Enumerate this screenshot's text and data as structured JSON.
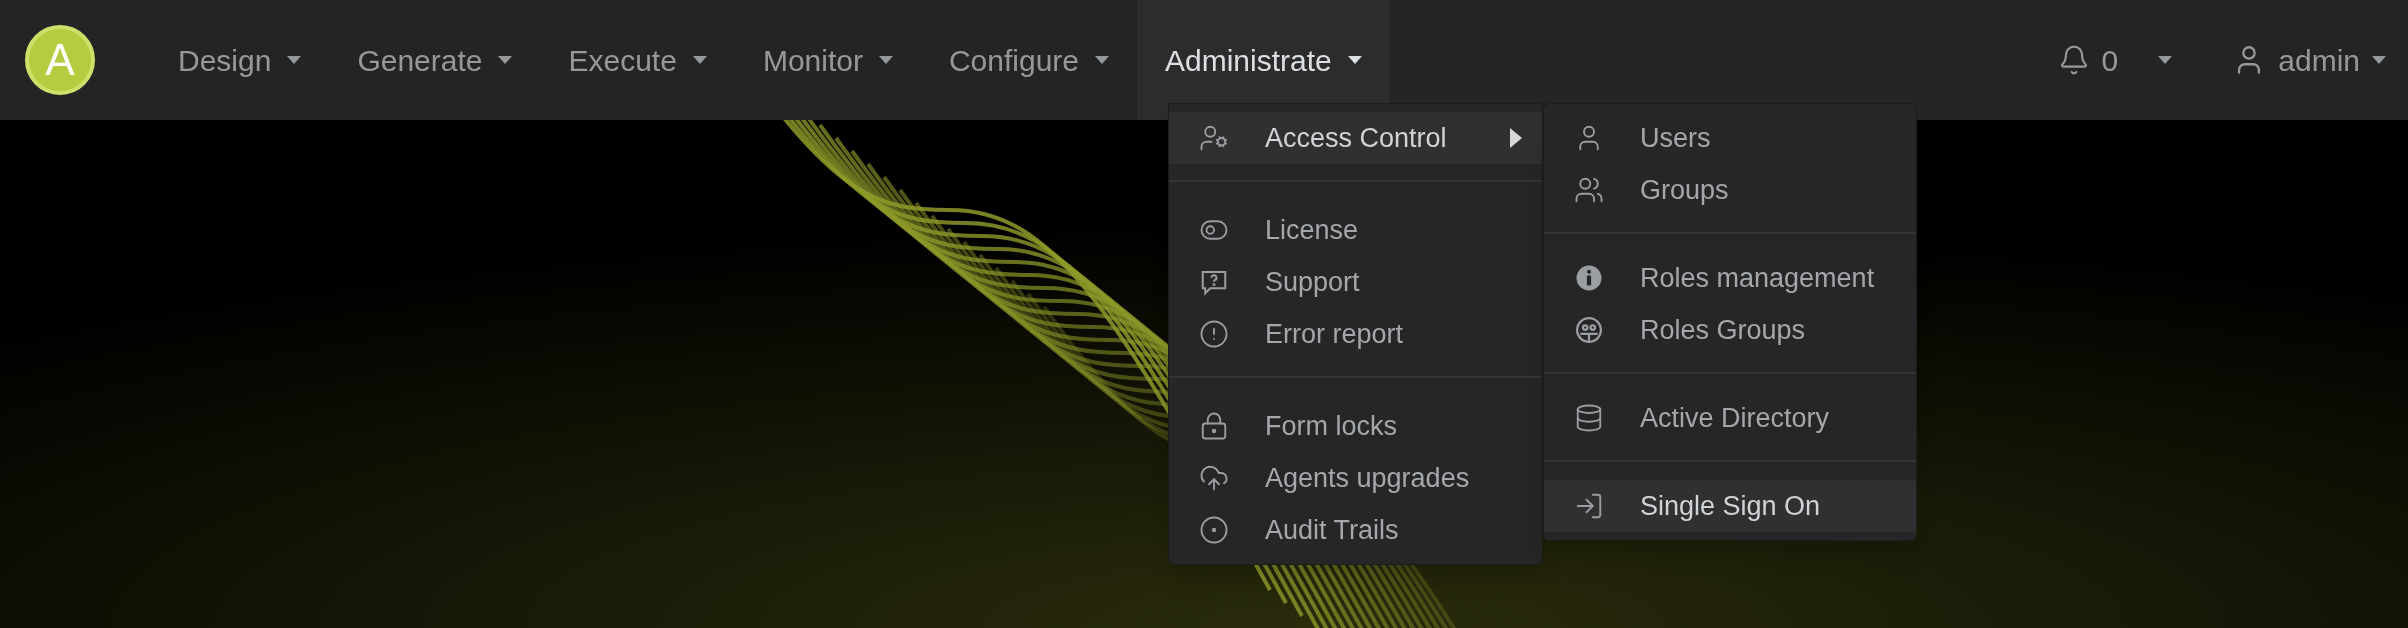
{
  "navbar": {
    "logo": "A",
    "items": [
      {
        "label": "Design",
        "selected": false
      },
      {
        "label": "Generate",
        "selected": false
      },
      {
        "label": "Execute",
        "selected": false
      },
      {
        "label": "Monitor",
        "selected": false
      },
      {
        "label": "Configure",
        "selected": false
      },
      {
        "label": "Administrate",
        "selected": true
      }
    ],
    "notifications": {
      "count": "0"
    },
    "user": {
      "name": "admin"
    }
  },
  "menu": {
    "groups": [
      {
        "items": [
          {
            "label": "Access Control",
            "selected": true,
            "submenu": true
          }
        ]
      },
      {
        "items": [
          {
            "label": "License",
            "selected": false,
            "submenu": false
          },
          {
            "label": "Support",
            "selected": false,
            "submenu": false
          },
          {
            "label": "Error report",
            "selected": false,
            "submenu": false
          }
        ]
      },
      {
        "items": [
          {
            "label": "Form locks",
            "selected": false,
            "submenu": false
          },
          {
            "label": "Agents upgrades",
            "selected": false,
            "submenu": false
          },
          {
            "label": "Audit Trails",
            "selected": false,
            "submenu": false
          }
        ]
      }
    ]
  },
  "submenu": {
    "groups": [
      {
        "items": [
          {
            "label": "Users",
            "selected": false
          },
          {
            "label": "Groups",
            "selected": false
          }
        ]
      },
      {
        "items": [
          {
            "label": "Roles management",
            "selected": false
          },
          {
            "label": "Roles Groups",
            "selected": false
          }
        ]
      },
      {
        "items": [
          {
            "label": "Active Directory",
            "selected": false
          }
        ]
      },
      {
        "items": [
          {
            "label": "Single Sign On",
            "selected": true
          }
        ]
      }
    ]
  }
}
